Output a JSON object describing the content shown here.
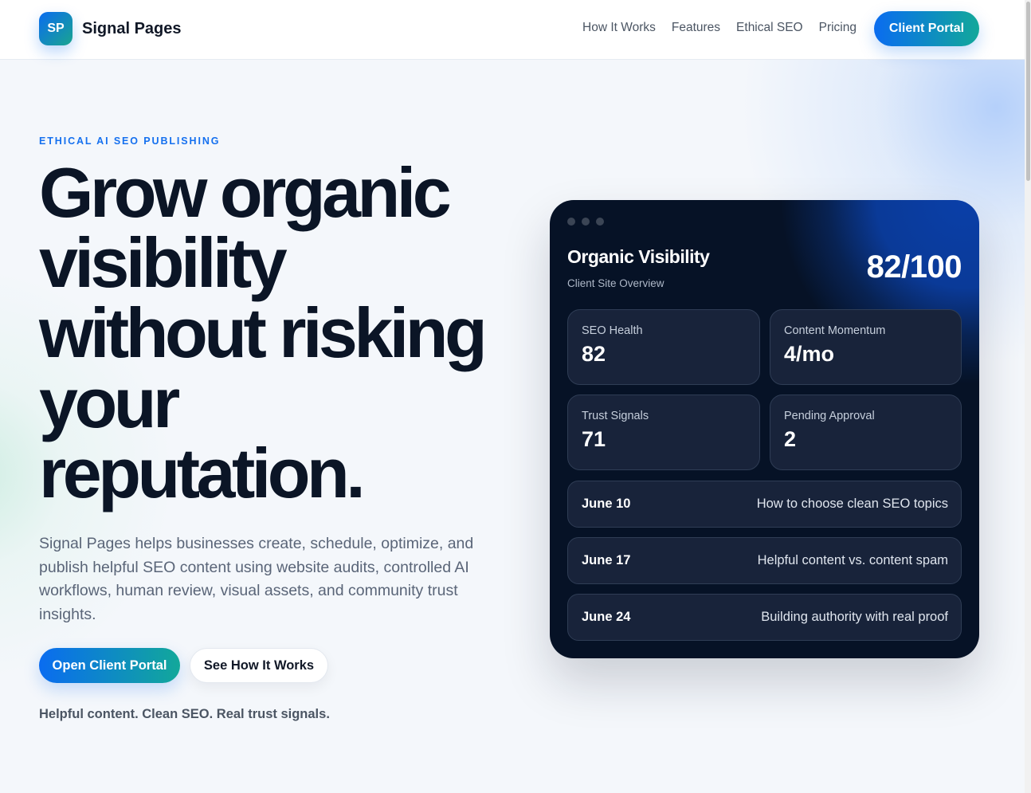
{
  "header": {
    "logo_text": "SP",
    "brand_name": "Signal Pages",
    "nav": [
      "How It Works",
      "Features",
      "Ethical SEO",
      "Pricing"
    ],
    "cta": "Client Portal"
  },
  "hero": {
    "eyebrow": "ETHICAL AI SEO PUBLISHING",
    "headline_lines": [
      "Grow organic",
      "visibility",
      "without risking",
      "your",
      "reputation."
    ],
    "lead": "Signal Pages helps businesses create, schedule, optimize, and publish helpful SEO content using website audits, controlled AI workflows, human review, visual assets, and community trust insights.",
    "primary_cta": "Open Client Portal",
    "secondary_cta": "See How It Works",
    "tagline": "Helpful content. Clean SEO. Real trust signals."
  },
  "dashboard": {
    "title": "Organic Visibility",
    "subtitle": "Client Site Overview",
    "score": "82/100",
    "metrics": [
      {
        "label": "SEO Health",
        "value": "82"
      },
      {
        "label": "Content Momentum",
        "value": "4/mo"
      },
      {
        "label": "Trust Signals",
        "value": "71"
      },
      {
        "label": "Pending Approval",
        "value": "2"
      }
    ],
    "schedule": [
      {
        "date": "June 10",
        "title": "How to choose clean SEO topics"
      },
      {
        "date": "June 17",
        "title": "Helpful content vs. content spam"
      },
      {
        "date": "June 24",
        "title": "Building authority with real proof"
      }
    ]
  },
  "colors": {
    "accent_blue": "#0a6cf0",
    "accent_teal": "#12a89a",
    "card_bg": "#061226",
    "heading": "#0b1526"
  }
}
